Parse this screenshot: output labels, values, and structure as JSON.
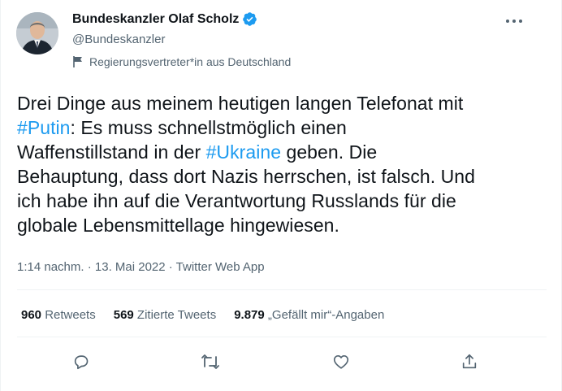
{
  "author": {
    "display_name": "Bundeskanzler Olaf Scholz",
    "handle": "@Bundeskanzler",
    "label": "Regierungsvertreter*in aus Deutschland"
  },
  "icons": {
    "verified": "verified-badge-icon",
    "flag": "flag-icon",
    "more": "more-options-icon",
    "reply": "reply-icon",
    "retweet": "retweet-icon",
    "like": "like-icon",
    "share": "share-icon"
  },
  "tweet": {
    "line1": "Drei Dinge aus meinem heutigen langen Telefonat mit",
    "line2_hashtag": "#Putin",
    "line2_rest": ": Es muss schnellstmöglich einen",
    "line3_start": "Waffenstillstand in der ",
    "line3_hashtag": "#Ukraine",
    "line3_rest": " geben. Die",
    "line4": "Behauptung, dass dort Nazis herrschen, ist falsch. Und",
    "line5": "ich habe ihn auf die Verantwortung Russlands für die",
    "line6": "globale Lebensmittellage hingewiesen."
  },
  "meta": {
    "text": "1:14 nachm. · 13. Mai 2022 · Twitter Web App"
  },
  "stats": {
    "retweets_count": "960",
    "retweets_label": " Retweets",
    "quotes_count": "569",
    "quotes_label": " Zitierte Tweets",
    "likes_count": "9.879",
    "likes_label": " „Gefällt mir“-Angaben"
  },
  "colors": {
    "accent": "#1d9bf0",
    "text": "#0f1419",
    "secondary": "#536471",
    "divider": "#eff3f4"
  }
}
